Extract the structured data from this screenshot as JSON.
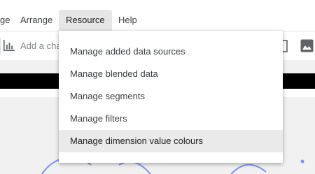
{
  "menubar": {
    "items": [
      {
        "label": "ge"
      },
      {
        "label": "Arrange"
      },
      {
        "label": "Resource",
        "active": true
      },
      {
        "label": "Help"
      }
    ]
  },
  "toolbar": {
    "add_chart_label": "Add a cha",
    "icons": [
      "bar-chart-icon",
      "frame-icon",
      "image-icon"
    ]
  },
  "resource_menu": {
    "items": [
      {
        "label": "Manage added data sources"
      },
      {
        "label": "Manage blended data"
      },
      {
        "label": "Manage segments"
      },
      {
        "label": "Manage filters"
      },
      {
        "label": "Manage dimension value colours",
        "hovered": true
      }
    ]
  },
  "colors": {
    "menu_active_bg": "#e6e6e6",
    "hover_bg": "#eaeaea",
    "canvas_bg": "#f1f1f1",
    "chart_line": "#7b93f2"
  }
}
